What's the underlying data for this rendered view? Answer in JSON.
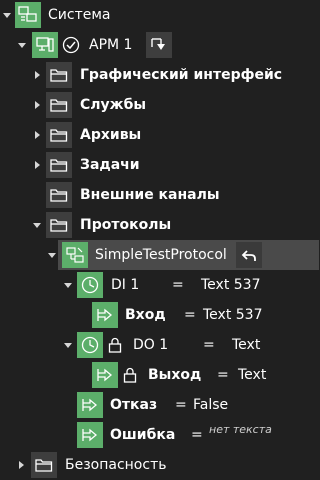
{
  "tree": {
    "root": {
      "label": "Система"
    },
    "arm": {
      "label": "АРМ 1"
    },
    "gui": {
      "label": "Графический интерфейс"
    },
    "services": {
      "label": "Службы"
    },
    "archives": {
      "label": "Архивы"
    },
    "tasks": {
      "label": "Задачи"
    },
    "external": {
      "label": "Внешние каналы"
    },
    "protocols": {
      "label": "Протоколы"
    },
    "protocol": {
      "label": "SimpleTestProtocol"
    },
    "di1": {
      "label": "DI 1",
      "eq": "=",
      "value": "Text 537"
    },
    "input": {
      "label": "Вход",
      "eq": "=",
      "value": "Text 537"
    },
    "do1": {
      "label": "DO 1",
      "eq": "=",
      "value": "Text"
    },
    "output": {
      "label": "Выход",
      "eq": "=",
      "value": "Text"
    },
    "refusal": {
      "label": "Отказ",
      "eq": "=",
      "value": "False"
    },
    "error": {
      "label": "Ошибка",
      "eq": "=",
      "value": "нет текста"
    },
    "security": {
      "label": "Безопасность"
    }
  },
  "colors": {
    "background": "#202020",
    "accent_green": "#5cae6a",
    "selected_row": "#4a4a4a",
    "icon_box": "#3e3e3e"
  }
}
